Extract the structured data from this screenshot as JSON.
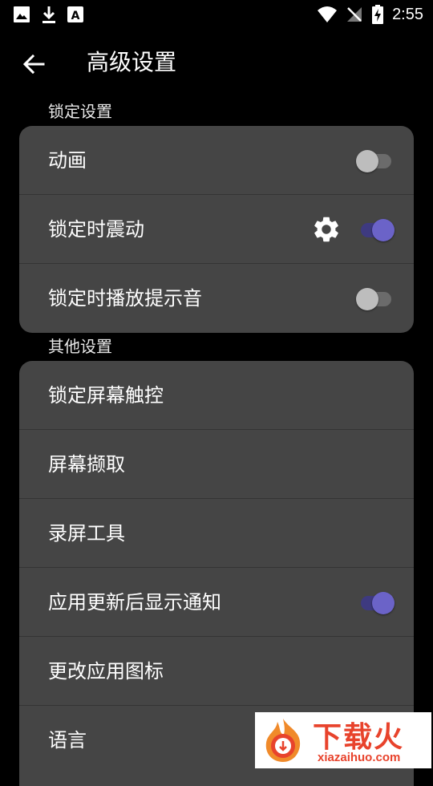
{
  "status_bar": {
    "time": "2:55",
    "icons": [
      "image-icon",
      "download-icon",
      "font-a-icon",
      "wifi-icon",
      "no-signal-icon",
      "battery-charging-icon"
    ]
  },
  "app_bar": {
    "back_icon": "arrow-back-icon",
    "title": "高级设置"
  },
  "lock_section": {
    "header": "锁定设置",
    "items": [
      {
        "label": "动画",
        "toggle_on": false
      },
      {
        "label": "锁定时震动",
        "toggle_on": true,
        "extra_icon": "gear-icon"
      },
      {
        "label": "锁定时播放提示音",
        "toggle_on": false
      }
    ]
  },
  "other_section": {
    "header": "其他设置",
    "items": [
      {
        "label": "锁定屏幕触控"
      },
      {
        "label": "屏幕撷取"
      },
      {
        "label": "录屏工具"
      },
      {
        "label": "应用更新后显示通知",
        "toggle_on": true
      },
      {
        "label": "更改应用图标"
      },
      {
        "label": "语言"
      }
    ]
  },
  "watermark": {
    "brand": "下载火",
    "url": "xiazaihuo.com"
  },
  "colors": {
    "background": "#000000",
    "card": "#454545",
    "toggle_on_thumb": "#6b63c8",
    "toggle_on_track": "#3e3a80",
    "toggle_off_thumb": "#bdbdbd",
    "toggle_off_track": "#6b6b6b",
    "watermark_accent": "#e8432c"
  }
}
